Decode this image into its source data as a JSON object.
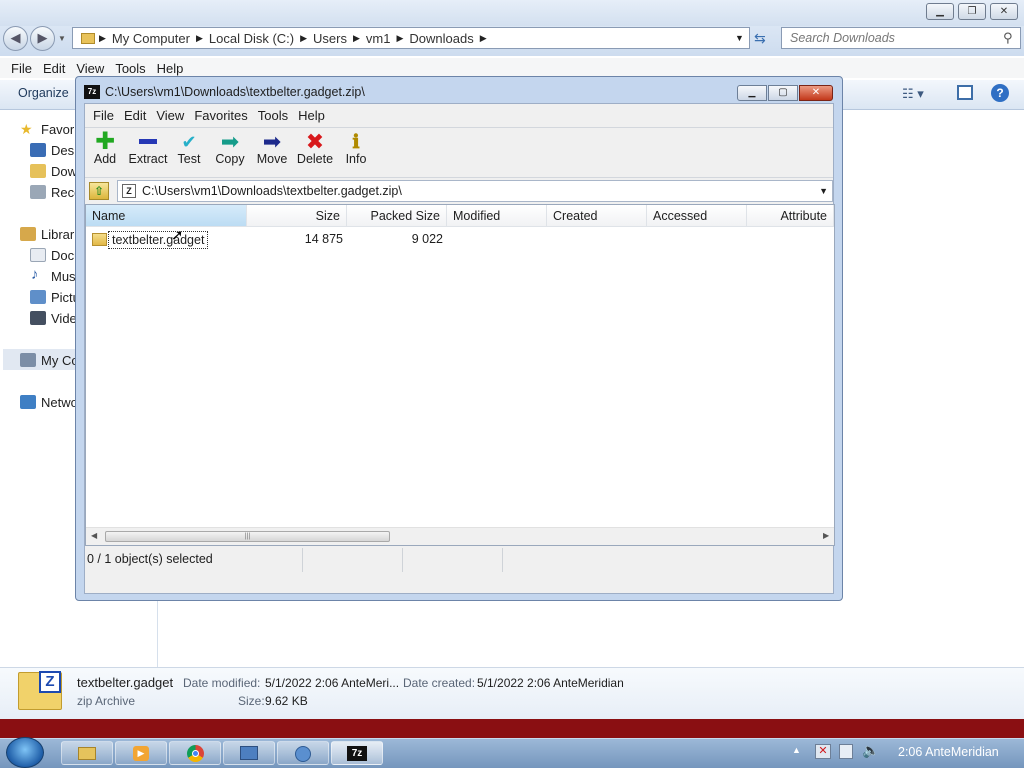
{
  "explorer": {
    "breadcrumb": [
      "My Computer",
      "Local Disk (C:)",
      "Users",
      "vm1",
      "Downloads"
    ],
    "search_placeholder": "Search Downloads",
    "menu": [
      "File",
      "Edit",
      "View",
      "Tools",
      "Help"
    ],
    "toolbar": {
      "organize": "Organize"
    },
    "nav": {
      "favorites": "Favorites",
      "desktop": "Desktop",
      "downloads": "Downloads",
      "recent": "Recent Places",
      "libraries": "Libraries",
      "documents": "Documents",
      "music": "Music",
      "pictures": "Pictures",
      "videos": "Videos",
      "computer": "My Computer",
      "network": "Network"
    },
    "details": {
      "name": "textbelter.gadget",
      "type": "zip Archive",
      "modified_label": "Date modified:",
      "modified_value": "5/1/2022 2:06 AnteMeri...",
      "created_label": "Date created:",
      "created_value": "5/1/2022 2:06 AnteMeridian",
      "size_label": "Size:",
      "size_value": "9.62 KB"
    }
  },
  "zip": {
    "title": "C:\\Users\\vm1\\Downloads\\textbelter.gadget.zip\\",
    "menu": [
      "File",
      "Edit",
      "View",
      "Favorites",
      "Tools",
      "Help"
    ],
    "tools": [
      "Add",
      "Extract",
      "Test",
      "Copy",
      "Move",
      "Delete",
      "Info"
    ],
    "address": "C:\\Users\\vm1\\Downloads\\textbelter.gadget.zip\\",
    "columns": {
      "name": "Name",
      "size": "Size",
      "packed": "Packed Size",
      "modified": "Modified",
      "created": "Created",
      "accessed": "Accessed",
      "attributes": "Attribute"
    },
    "row": {
      "name": "textbelter.gadget",
      "size": "14 875",
      "packed": "9 022"
    },
    "status": "0 / 1 object(s) selected"
  },
  "taskbar": {
    "clock": "2:06 AnteMeridian"
  }
}
